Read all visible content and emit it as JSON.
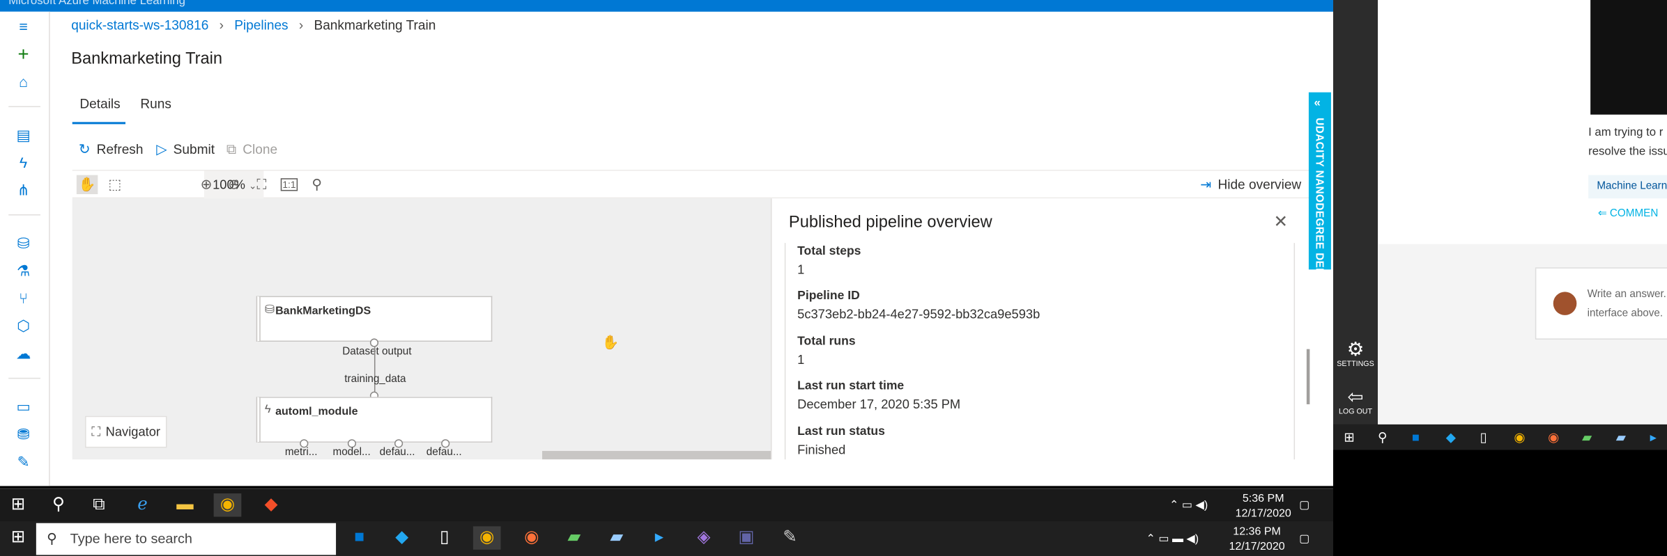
{
  "topbar": {
    "title": "Microsoft Azure Machine Learning"
  },
  "breadcrumb": {
    "workspace": "quick-starts-ws-130816",
    "section": "Pipelines",
    "current": "Bankmarketing Train"
  },
  "page": {
    "title": "Bankmarketing Train"
  },
  "tabs": {
    "details": "Details",
    "runs": "Runs"
  },
  "commands": {
    "refresh": "Refresh",
    "submit": "Submit",
    "clone": "Clone"
  },
  "toolbar": {
    "zoom": "100%",
    "hide_overview": "Hide overview",
    "actual_size": "1:1"
  },
  "graph": {
    "node1": "BankMarketingDS",
    "node1_output": "Dataset output",
    "node2_input": "training_data",
    "node2": "automl_module",
    "node2_ports": [
      "metri...",
      "model...",
      "defau...",
      "defau..."
    ],
    "navigator": "Navigator"
  },
  "overview": {
    "title": "Published pipeline overview",
    "fields": [
      {
        "key": "Total steps",
        "value": "1"
      },
      {
        "key": "Pipeline ID",
        "value": "5c373eb2-bb24-4e27-9592-bb32ca9e593b"
      },
      {
        "key": "Total runs",
        "value": "1"
      },
      {
        "key": "Last run start time",
        "value": "December 17, 2020 5:35 PM"
      },
      {
        "key": "Last run status",
        "value": "Finished"
      }
    ]
  },
  "udacity": {
    "banner": "UDACITY NANODEGREE DEMO",
    "settings": "SETTINGS",
    "logout": "LOG OUT"
  },
  "right_panel": {
    "text_line1": "I am trying to r",
    "text_line2": "resolve the issu",
    "tag": "Machine Learn",
    "comment": "COMMEN",
    "answer_line1": "Write an answer..",
    "answer_line2": "interface above."
  },
  "taskbar_inner": {
    "time": "5:36 PM",
    "date": "12/17/2020"
  },
  "taskbar_outer": {
    "search_placeholder": "Type here to search",
    "time": "12:36 PM",
    "date": "12/17/2020"
  },
  "colors": {
    "azure_blue": "#0078d4",
    "udacity_blue": "#02b3e4"
  }
}
